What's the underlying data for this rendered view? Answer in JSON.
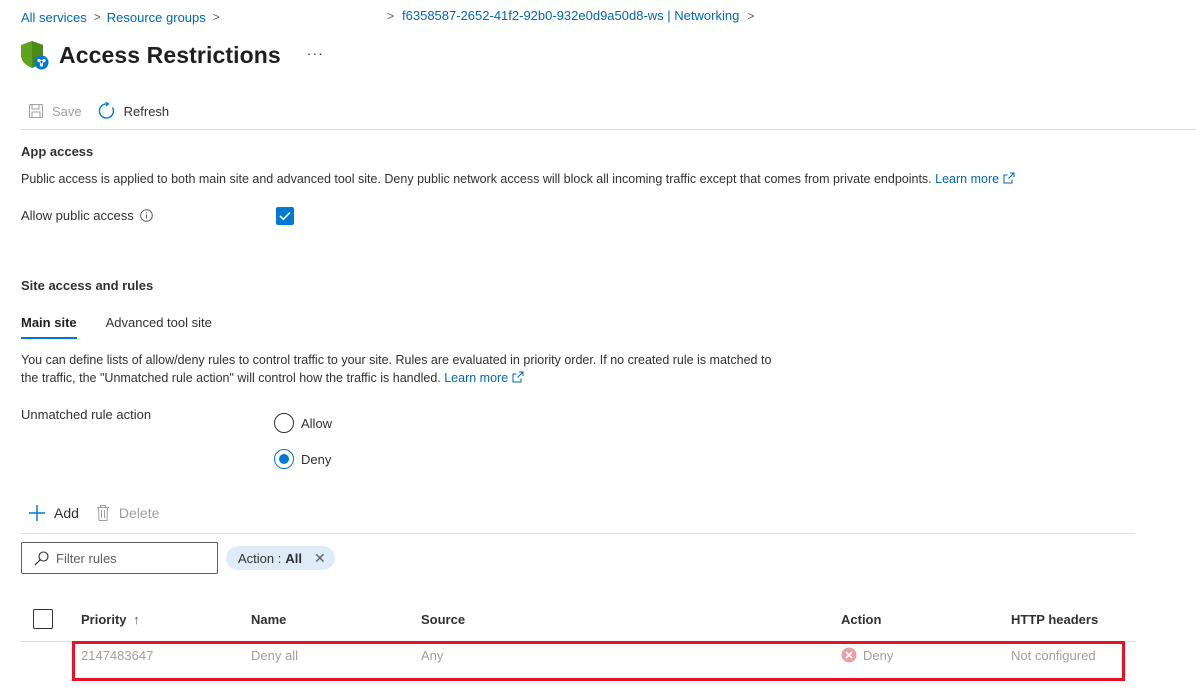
{
  "breadcrumb": {
    "items": [
      "All services",
      "Resource groups"
    ],
    "current": "f6358587-2652-41f2-92b0-932e0d9a50d8-ws | Networking"
  },
  "header": {
    "title": "Access Restrictions",
    "more": "···",
    "icon": "shield-network-icon"
  },
  "toolbar": {
    "save_label": "Save",
    "refresh_label": "Refresh"
  },
  "app_access": {
    "title": "App access",
    "description": "Public access is applied to both main site and advanced tool site. Deny public network access will block all incoming traffic except that comes from private endpoints.",
    "learn_more": "Learn more",
    "allow_public_label": "Allow public access",
    "allow_public_checked": true
  },
  "site_access": {
    "title": "Site access and rules",
    "tabs": [
      {
        "label": "Main site",
        "active": true
      },
      {
        "label": "Advanced tool site",
        "active": false
      }
    ],
    "description_line1": "You can define lists of allow/deny rules to control traffic to your site. Rules are evaluated in priority order. If no created rule is matched to",
    "description_line2": "the traffic, the \"Unmatched rule action\" will control how the traffic is handled.",
    "learn_more": "Learn more",
    "unmatched_label": "Unmatched rule action",
    "options": [
      {
        "label": "Allow",
        "checked": false
      },
      {
        "label": "Deny",
        "checked": true
      }
    ]
  },
  "commands": {
    "add_label": "Add",
    "delete_label": "Delete"
  },
  "filter": {
    "placeholder": "Filter rules",
    "pill_key": "Action :",
    "pill_value": "All"
  },
  "table": {
    "columns": [
      "Priority",
      "Name",
      "Source",
      "Action",
      "HTTP headers"
    ],
    "sort_indicator": "↑",
    "rows": [
      {
        "priority": "2147483647",
        "name": "Deny all",
        "source": "Any",
        "action": "Deny",
        "http_headers": "Not configured"
      }
    ]
  },
  "colors": {
    "accent": "#0078d4",
    "link": "#0067b8",
    "highlight": "#e81123",
    "deny": "#e8a0a4"
  }
}
